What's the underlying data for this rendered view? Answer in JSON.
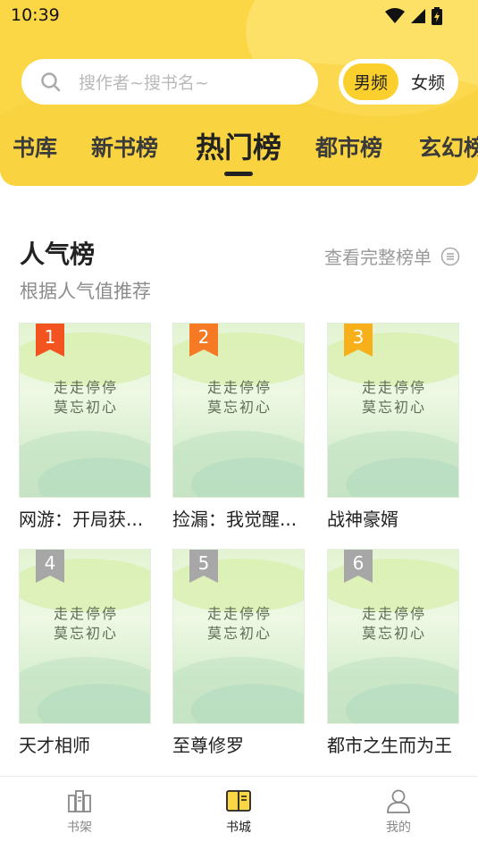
{
  "status_bar": {
    "time": "10:39"
  },
  "search": {
    "placeholder": "搜作者~搜书名~"
  },
  "gender": {
    "male": "男频",
    "female": "女频",
    "selected": "男频"
  },
  "tabs": [
    {
      "label": "书库"
    },
    {
      "label": "新书榜"
    },
    {
      "label": "热门榜"
    },
    {
      "label": "都市榜"
    },
    {
      "label": "玄幻榜"
    }
  ],
  "active_tab": "热门榜",
  "section": {
    "title": "人气榜",
    "subtitle": "根据人气值推荐",
    "view_all": "查看完整榜单"
  },
  "cover": {
    "line1": "走走停停",
    "line2": "莫忘初心"
  },
  "books": [
    {
      "rank": "1",
      "title": "网游：开局获...",
      "badge_color": "#f2531f"
    },
    {
      "rank": "2",
      "title": "捡漏：我觉醒...",
      "badge_color": "#f57a23"
    },
    {
      "rank": "3",
      "title": "战神豪婿",
      "badge_color": "#f7b01a"
    },
    {
      "rank": "4",
      "title": "天才相师",
      "badge_color": "#a7a7a7"
    },
    {
      "rank": "5",
      "title": "至尊修罗",
      "badge_color": "#a7a7a7"
    },
    {
      "rank": "6",
      "title": "都市之生而为王",
      "badge_color": "#a7a7a7"
    }
  ],
  "bottom_nav": [
    {
      "label": "书架",
      "icon": "bookshelf-icon"
    },
    {
      "label": "书城",
      "icon": "book-store-icon",
      "active": true
    },
    {
      "label": "我的",
      "icon": "profile-icon"
    }
  ],
  "colors": {
    "accent": "#fbd645",
    "toggle": "#fbd02c"
  }
}
